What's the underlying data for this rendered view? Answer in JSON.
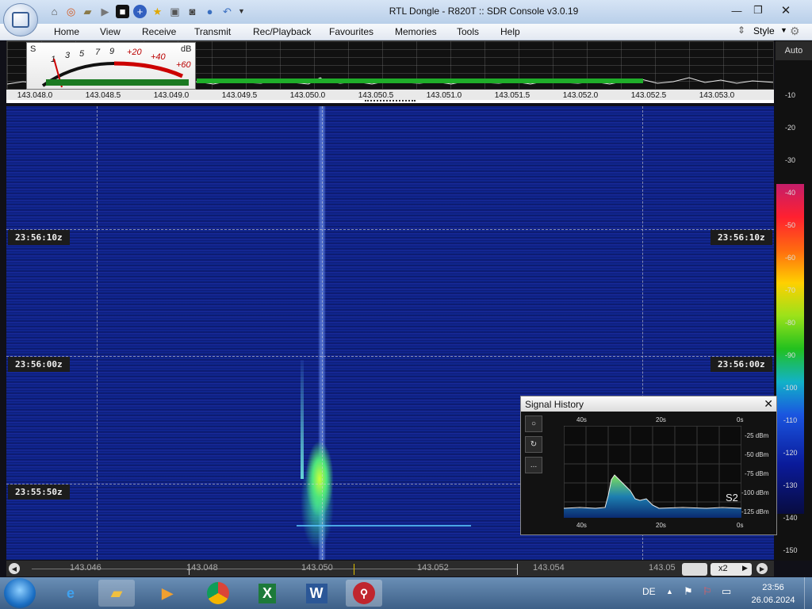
{
  "window": {
    "title": "RTL Dongle - R820T :: SDR Console v3.0.19"
  },
  "menu": {
    "items": [
      "Home",
      "View",
      "Receive",
      "Transmit",
      "Rec/Playback",
      "Favourites",
      "Memories",
      "Tools",
      "Help"
    ],
    "style_label": "Style"
  },
  "smeter": {
    "s_label": "S",
    "scale": [
      "1",
      "3",
      "5",
      "7",
      "9"
    ],
    "plus_scale": [
      "+20",
      "+40",
      "+60"
    ],
    "unit": "dB"
  },
  "spectrum": {
    "freq_ticks": [
      "143.048.0",
      "143.048.5",
      "143.049.0",
      "143.049.5",
      "143.050.0",
      "143.050.5",
      "143.051.0",
      "143.051.5",
      "143.052.0",
      "143.052.5",
      "143.053.0"
    ]
  },
  "db_scale": {
    "auto_label": "Auto",
    "ticks": [
      "-10",
      "-20",
      "-30",
      "-40",
      "-50",
      "-60",
      "-70",
      "-80",
      "-90",
      "-100",
      "-110",
      "-120",
      "-130",
      "-140",
      "-150"
    ]
  },
  "waterfall": {
    "time_labels": [
      "23:56:10z",
      "23:56:00z",
      "23:55:50z"
    ]
  },
  "signal_history": {
    "title": "Signal History",
    "close_label": "✕",
    "buttons": [
      "○",
      "↻",
      "..."
    ],
    "time_top": [
      "40s",
      "20s",
      "0s"
    ],
    "time_bottom": [
      "40s",
      "20s",
      "0s"
    ],
    "dbm_labels": [
      "-25 dBm",
      "-50 dBm",
      "-75 dBm",
      "-100 dBm",
      "-125 dBm"
    ],
    "s_reading": "S2"
  },
  "bottom_freq": {
    "ticks": [
      "143.046",
      "143.048",
      "143.050",
      "143.052",
      "143.054",
      "143.05"
    ],
    "zoom_label": "x2"
  },
  "taskbar": {
    "language": "DE",
    "time": "23:56",
    "date": "26.06.2024"
  },
  "colors": {
    "waterfall_bg": "#0d1d80",
    "signal": "#4fe67c",
    "spectrum_bar": "#1fae2a"
  }
}
